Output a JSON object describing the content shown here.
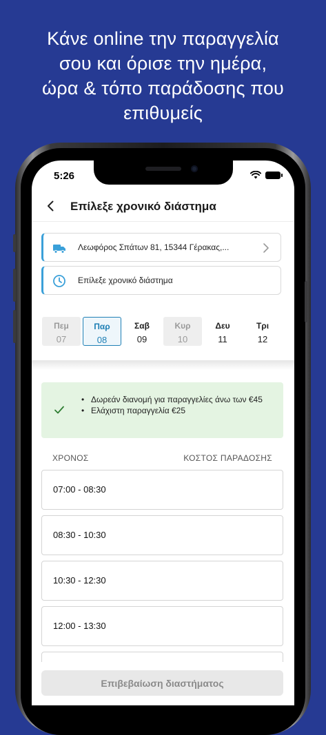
{
  "headline": [
    "Κάνε online την παραγγελία",
    "σου και όρισε την ημέρα,",
    "ώρα & τόπο παράδοσης που",
    "επιθυμείς"
  ],
  "status_bar": {
    "time": "5:26"
  },
  "nav": {
    "title": "Επίλεξε χρονικό διάστημα"
  },
  "address_card": {
    "text": "Λεωφόρος Σπάτων 81, 15344 Γέρακας,..."
  },
  "time_card": {
    "text": "Επίλεξε χρονικό διάστημα"
  },
  "days": [
    {
      "name": "Πεμ",
      "date": "07",
      "state": "disabled"
    },
    {
      "name": "Παρ",
      "date": "08",
      "state": "selected"
    },
    {
      "name": "Σαβ",
      "date": "09",
      "state": "available"
    },
    {
      "name": "Κυρ",
      "date": "10",
      "state": "disabled"
    },
    {
      "name": "Δευ",
      "date": "11",
      "state": "available"
    },
    {
      "name": "Τρι",
      "date": "12",
      "state": "available"
    }
  ],
  "info": {
    "items": [
      "Δωρεάν διανομή για παραγγελίες άνω των €45",
      "Ελάχιστη παραγγελία €25"
    ]
  },
  "columns": {
    "time": "ΧΡΟΝΟΣ",
    "cost": "ΚΟΣΤΟΣ ΠΑΡΑΔΟΣΗΣ"
  },
  "slots": [
    "07:00 - 08:30",
    "08:30 - 10:30",
    "10:30 - 12:30",
    "12:00 - 13:30"
  ],
  "confirm_button": {
    "label": "Επιβεβαίωση διαστήματος"
  },
  "colors": {
    "background": "#263a93",
    "accent": "#1e7fb5",
    "card_accent": "#3aa0d9",
    "info_bg": "#e4f4e2",
    "check": "#2e7d32"
  }
}
